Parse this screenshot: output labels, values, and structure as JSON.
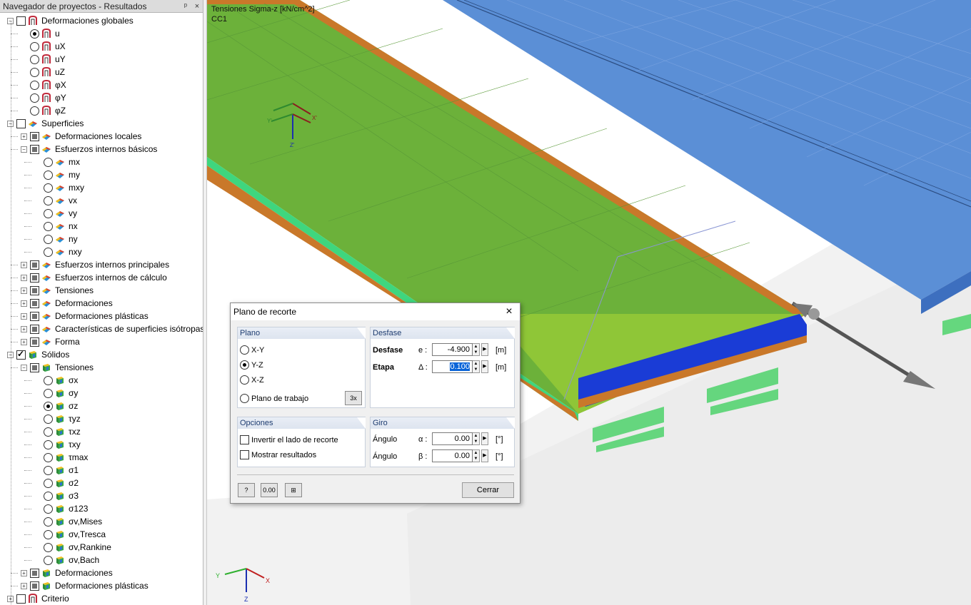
{
  "navigator": {
    "title": "Navegador de proyectos - Resultados",
    "pin": "ᵖ",
    "close": "×",
    "rows": [
      {
        "d": 0,
        "exp": "-",
        "cb": "empty",
        "ico": "def",
        "t": "Deformaciones globales"
      },
      {
        "d": 1,
        "rb": "on",
        "ico": "def",
        "t": "u"
      },
      {
        "d": 1,
        "rb": "off",
        "ico": "def",
        "t": "uX"
      },
      {
        "d": 1,
        "rb": "off",
        "ico": "def",
        "t": "uY"
      },
      {
        "d": 1,
        "rb": "off",
        "ico": "def",
        "t": "uZ"
      },
      {
        "d": 1,
        "rb": "off",
        "ico": "def",
        "t": "φX"
      },
      {
        "d": 1,
        "rb": "off",
        "ico": "def",
        "t": "φY"
      },
      {
        "d": 1,
        "rb": "off",
        "ico": "def",
        "t": "φZ"
      },
      {
        "d": 0,
        "exp": "-",
        "cb": "empty",
        "ico": "surf",
        "t": "Superficies"
      },
      {
        "d": 1,
        "exp": "+",
        "cb": "part",
        "ico": "surf",
        "t": "Deformaciones locales"
      },
      {
        "d": 1,
        "exp": "-",
        "cb": "part",
        "ico": "surf",
        "t": "Esfuerzos internos básicos"
      },
      {
        "d": 2,
        "rb": "off",
        "ico": "surf",
        "t": "mx"
      },
      {
        "d": 2,
        "rb": "off",
        "ico": "surf",
        "t": "my"
      },
      {
        "d": 2,
        "rb": "off",
        "ico": "surf",
        "t": "mxy"
      },
      {
        "d": 2,
        "rb": "off",
        "ico": "surf",
        "t": "vx"
      },
      {
        "d": 2,
        "rb": "off",
        "ico": "surf",
        "t": "vy"
      },
      {
        "d": 2,
        "rb": "off",
        "ico": "surf",
        "t": "nx"
      },
      {
        "d": 2,
        "rb": "off",
        "ico": "surf",
        "t": "ny"
      },
      {
        "d": 2,
        "rb": "off",
        "ico": "surf",
        "t": "nxy"
      },
      {
        "d": 1,
        "exp": "+",
        "cb": "part",
        "ico": "surf",
        "t": "Esfuerzos internos principales"
      },
      {
        "d": 1,
        "exp": "+",
        "cb": "part",
        "ico": "surf",
        "t": "Esfuerzos internos de cálculo"
      },
      {
        "d": 1,
        "exp": "+",
        "cb": "part",
        "ico": "surf",
        "t": "Tensiones"
      },
      {
        "d": 1,
        "exp": "+",
        "cb": "part",
        "ico": "surf",
        "t": "Deformaciones"
      },
      {
        "d": 1,
        "exp": "+",
        "cb": "part",
        "ico": "surf",
        "t": "Deformaciones plásticas"
      },
      {
        "d": 1,
        "exp": "+",
        "cb": "part",
        "ico": "surf",
        "t": "Características de superficies isótropas"
      },
      {
        "d": 1,
        "exp": "+",
        "cb": "part",
        "ico": "surf",
        "t": "Forma"
      },
      {
        "d": 0,
        "exp": "-",
        "cb": "chk",
        "ico": "solid",
        "t": "Sólidos"
      },
      {
        "d": 1,
        "exp": "-",
        "cb": "part",
        "ico": "solid",
        "t": "Tensiones"
      },
      {
        "d": 2,
        "rb": "off",
        "ico": "solid",
        "t": "σx"
      },
      {
        "d": 2,
        "rb": "off",
        "ico": "solid",
        "t": "σy"
      },
      {
        "d": 2,
        "rb": "on",
        "ico": "solid",
        "t": "σz"
      },
      {
        "d": 2,
        "rb": "off",
        "ico": "solid",
        "t": "τyz"
      },
      {
        "d": 2,
        "rb": "off",
        "ico": "solid",
        "t": "τxz"
      },
      {
        "d": 2,
        "rb": "off",
        "ico": "solid",
        "t": "τxy"
      },
      {
        "d": 2,
        "rb": "off",
        "ico": "solid",
        "t": "τmax"
      },
      {
        "d": 2,
        "rb": "off",
        "ico": "solid",
        "t": "σ1"
      },
      {
        "d": 2,
        "rb": "off",
        "ico": "solid",
        "t": "σ2"
      },
      {
        "d": 2,
        "rb": "off",
        "ico": "solid",
        "t": "σ3"
      },
      {
        "d": 2,
        "rb": "off",
        "ico": "solid",
        "t": "σ123"
      },
      {
        "d": 2,
        "rb": "off",
        "ico": "solid",
        "t": "σv,Mises"
      },
      {
        "d": 2,
        "rb": "off",
        "ico": "solid",
        "t": "σv,Tresca"
      },
      {
        "d": 2,
        "rb": "off",
        "ico": "solid",
        "t": "σv,Rankine"
      },
      {
        "d": 2,
        "rb": "off",
        "ico": "solid",
        "t": "σv,Bach"
      },
      {
        "d": 1,
        "exp": "+",
        "cb": "part",
        "ico": "solid",
        "t": "Deformaciones"
      },
      {
        "d": 1,
        "exp": "+",
        "cb": "part",
        "ico": "solid",
        "t": "Deformaciones plásticas"
      },
      {
        "d": 0,
        "exp": "+",
        "cb": "empty",
        "ico": "def",
        "t": "Criterio"
      }
    ]
  },
  "view": {
    "result_label": "Tensiones Sigma-z [kN/cm^2]",
    "load_case": "CC1",
    "axes": {
      "x": "X",
      "y": "Y",
      "z": "Z",
      "x2": "X'",
      "y2": "Y'",
      "z2": "Z'"
    }
  },
  "dialog": {
    "title": "Plano de recorte",
    "close": "×",
    "plano": {
      "header": "Plano",
      "options": [
        "X-Y",
        "Y-Z",
        "X-Z",
        "Plano de trabajo"
      ],
      "selected": "Y-Z"
    },
    "desfase": {
      "header": "Desfase",
      "rows": [
        {
          "label": "Desfase",
          "sym": "e :",
          "value": "-4.900",
          "unit": "[m]",
          "bold": true
        },
        {
          "label": "Etapa",
          "sym": "Δ :",
          "value": "0.100",
          "unit": "[m]",
          "bold": true
        }
      ]
    },
    "opciones": {
      "header": "Opciones",
      "items": [
        {
          "label": "Invertir el lado de recorte",
          "checked": false
        },
        {
          "label": "Mostrar resultados",
          "checked": false
        }
      ]
    },
    "giro": {
      "header": "Giro",
      "rows": [
        {
          "label": "Ángulo",
          "sym": "α :",
          "value": "0.00",
          "unit": "[°]"
        },
        {
          "label": "Ángulo",
          "sym": "β :",
          "value": "0.00",
          "unit": "[°]"
        }
      ]
    },
    "buttons": {
      "help": "?",
      "units": "0.00",
      "table": "⊞",
      "close": "Cerrar"
    }
  }
}
